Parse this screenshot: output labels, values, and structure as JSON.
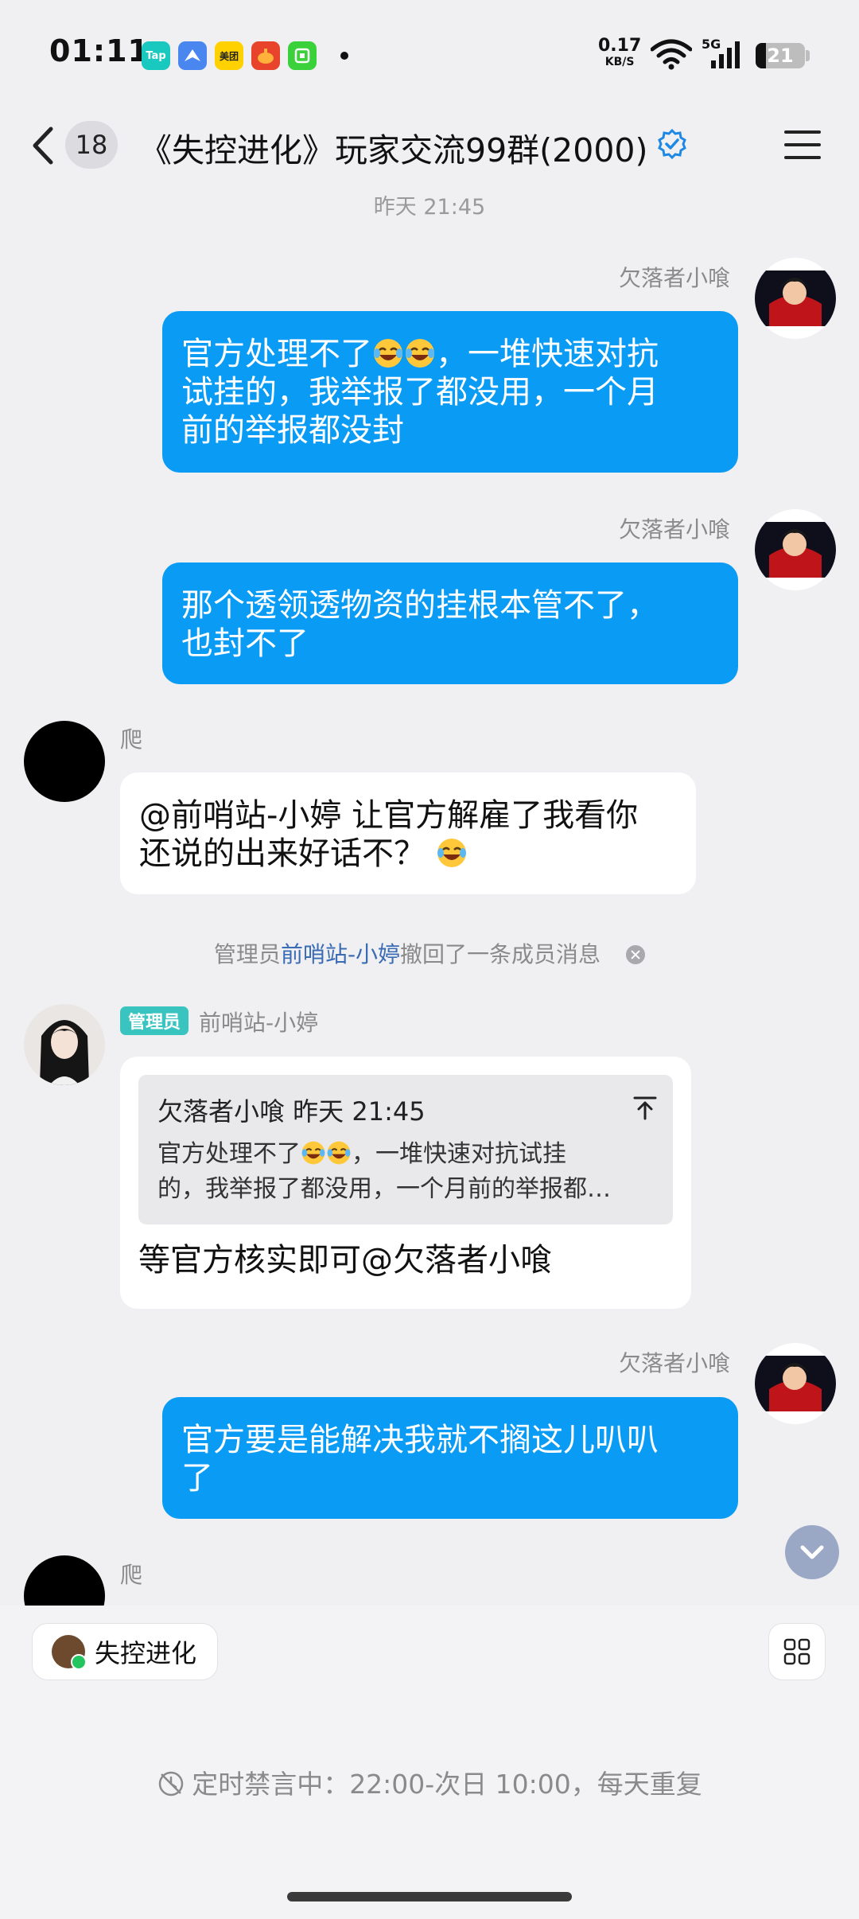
{
  "status_bar": {
    "time": "01:11",
    "app_icons": [
      {
        "name": "tap-icon",
        "label": "Tap",
        "color": "#19c9bf"
      },
      {
        "name": "bird-app-icon",
        "label": "",
        "color": "#4a86f0"
      },
      {
        "name": "meituan-icon",
        "label": "美团",
        "color": "#ffd100"
      },
      {
        "name": "red-app-icon",
        "label": "",
        "color": "#e8432b"
      },
      {
        "name": "green-app-icon",
        "label": "",
        "color": "#3ad13a"
      }
    ],
    "net_speed": "0.17",
    "net_unit": "KB/S",
    "network": "5G",
    "battery": "21",
    "battery_level": 0.21
  },
  "header": {
    "unread_count": "18",
    "title": "《失控进化》玩家交流99群(2000)"
  },
  "time_divider": "昨天 21:45",
  "messages": {
    "m1": {
      "sender": "欠落者小喰",
      "text": "官方处理不了😂😂，一堆快速对抗试挂的，我举报了都没用，一个月前的举报都没封",
      "lines": [
        "官方处理不了",
        "，一堆快速对抗",
        "试挂的，我举报了都没用，一个月",
        "前的举报都没封"
      ]
    },
    "m2": {
      "sender": "欠落者小喰",
      "lines": [
        "那个透领透物资的挂根本管不了，",
        "也封不了"
      ]
    },
    "m3": {
      "sender": "爬",
      "lines": [
        "@前哨站-小婷 让官方解雇了我看你",
        "还说的出来好话不？"
      ]
    },
    "system": {
      "prefix": "管理员",
      "link": "前哨站-小婷",
      "suffix": "撤回了一条成员消息"
    },
    "m4": {
      "role": "管理员",
      "sender": "前哨站-小婷",
      "quote_header": "欠落者小喰 昨天 21:45",
      "quote_lines": [
        "官方处理不了",
        "，一堆快速对抗试挂",
        "的，我举报了都没用，一个月前的举报都…"
      ],
      "text": "等官方核实即可@欠落者小喰"
    },
    "m5": {
      "sender": "欠落者小喰",
      "lines": [
        "官方要是能解决我就不搁这儿叭叭",
        "了"
      ]
    },
    "m6": {
      "sender": "爬"
    }
  },
  "bottom": {
    "shortcut_label": "失控进化",
    "mute_notice": "定时禁言中：22:00-次日 10:00，每天重复"
  },
  "colors": {
    "outgoing_bubble": "#0a9bf5",
    "admin_tag": "#39c4c0",
    "mention_link": "#3a6bb5",
    "verified_badge": "#1e88e5"
  }
}
